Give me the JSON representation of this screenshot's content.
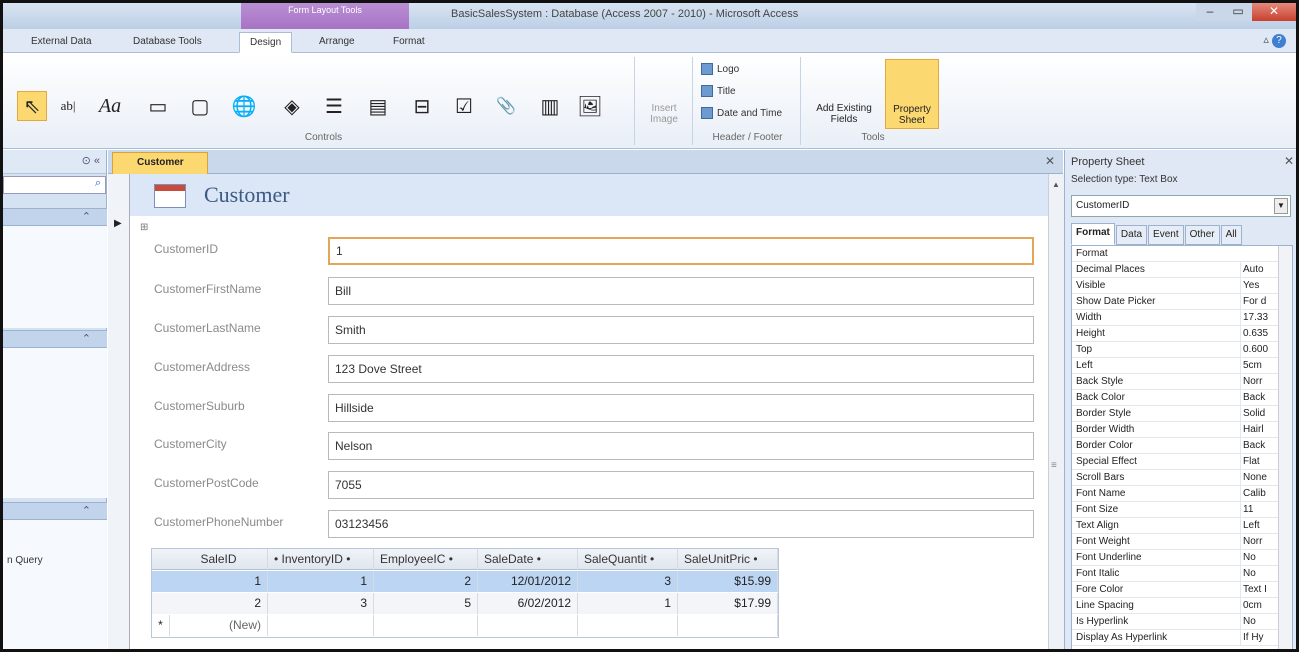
{
  "titlebar": {
    "context_tab": "Form Layout Tools",
    "app_title": "BasicSalesSystem : Database (Access 2007 - 2010) - Microsoft Access",
    "minimize": "–",
    "restore": "▭",
    "close": "✕"
  },
  "ribbon_tabs": [
    "External Data",
    "Database Tools",
    "Design",
    "Arrange",
    "Format"
  ],
  "help": {
    "caret": "▵",
    "icon": "?"
  },
  "controls_group": {
    "label": "Controls",
    "items": [
      {
        "name": "select-pointer-icon",
        "glyph": "⇖"
      },
      {
        "name": "textbox-icon",
        "glyph": "ab|"
      },
      {
        "name": "label-icon",
        "glyph": "Aa"
      },
      {
        "name": "button-icon",
        "glyph": "▭"
      },
      {
        "name": "tab-control-icon",
        "glyph": "▢"
      },
      {
        "name": "hyperlink-globe-icon",
        "glyph": "🌐"
      },
      {
        "name": "web-browser-icon",
        "glyph": "◈"
      },
      {
        "name": "navigation-control-icon",
        "glyph": "☰"
      },
      {
        "name": "option-group-icon",
        "glyph": "▤"
      },
      {
        "name": "page-break-icon",
        "glyph": "⊟"
      },
      {
        "name": "checkbox-icon",
        "glyph": "☑"
      },
      {
        "name": "attachment-clip-icon",
        "glyph": "📎"
      },
      {
        "name": "combo-box-icon",
        "glyph": "▥"
      },
      {
        "name": "image-icon",
        "glyph": "🖼"
      }
    ],
    "insert_image_label": "Insert Image"
  },
  "header_footer": {
    "label": "Header / Footer",
    "logo": "Logo",
    "title": "Title",
    "date_time": "Date and Time"
  },
  "tools": {
    "label": "Tools",
    "add_existing": "Add Existing Fields",
    "property_sheet": "Property Sheet"
  },
  "nav": {
    "search_icon": "⌕",
    "item_query": "n Query"
  },
  "document": {
    "tab_label": "Customer",
    "form_title": "Customer",
    "close": "✕"
  },
  "fields": [
    {
      "label": "CustomerID",
      "value": "1"
    },
    {
      "label": "CustomerFirstName",
      "value": "Bill"
    },
    {
      "label": "CustomerLastName",
      "value": "Smith"
    },
    {
      "label": "CustomerAddress",
      "value": "123 Dove Street"
    },
    {
      "label": "CustomerSuburb",
      "value": "Hillside"
    },
    {
      "label": "CustomerCity",
      "value": "Nelson"
    },
    {
      "label": "CustomerPostCode",
      "value": "7055"
    },
    {
      "label": "CustomerPhoneNumber",
      "value": "03123456"
    }
  ],
  "subform": {
    "columns": [
      "SaleID",
      "• InventoryID •",
      "EmployeeIC •",
      "SaleDate •",
      "SaleQuantit •",
      "SaleUnitPric •"
    ],
    "rows": [
      [
        "1",
        "1",
        "2",
        "12/01/2012",
        "3",
        "$15.99"
      ],
      [
        "2",
        "3",
        "5",
        "6/02/2012",
        "1",
        "$17.99"
      ]
    ],
    "new_marker": "*",
    "new_label": "(New)"
  },
  "property_sheet": {
    "title": "Property Sheet",
    "selection_type": "Selection type:  Text Box",
    "selected": "CustomerID",
    "tabs": [
      "Format",
      "Data",
      "Event",
      "Other",
      "All"
    ],
    "rows": [
      [
        "Format",
        ""
      ],
      [
        "Decimal Places",
        "Auto"
      ],
      [
        "Visible",
        "Yes"
      ],
      [
        "Show Date Picker",
        "For d"
      ],
      [
        "Width",
        "17.33"
      ],
      [
        "Height",
        "0.635"
      ],
      [
        "Top",
        "0.600"
      ],
      [
        "Left",
        "5cm"
      ],
      [
        "Back Style",
        "Norr"
      ],
      [
        "Back Color",
        "Back"
      ],
      [
        "Border Style",
        "Solid"
      ],
      [
        "Border Width",
        "Hairl"
      ],
      [
        "Border Color",
        "Back"
      ],
      [
        "Special Effect",
        "Flat"
      ],
      [
        "Scroll Bars",
        "None"
      ],
      [
        "Font Name",
        "Calib"
      ],
      [
        "Font Size",
        "11"
      ],
      [
        "Text Align",
        "Left"
      ],
      [
        "Font Weight",
        "Norr"
      ],
      [
        "Font Underline",
        "No"
      ],
      [
        "Font Italic",
        "No"
      ],
      [
        "Fore Color",
        "Text I"
      ],
      [
        "Line Spacing",
        "0cm"
      ],
      [
        "Is Hyperlink",
        "No"
      ],
      [
        "Display As Hyperlink",
        "If Hy"
      ]
    ]
  }
}
